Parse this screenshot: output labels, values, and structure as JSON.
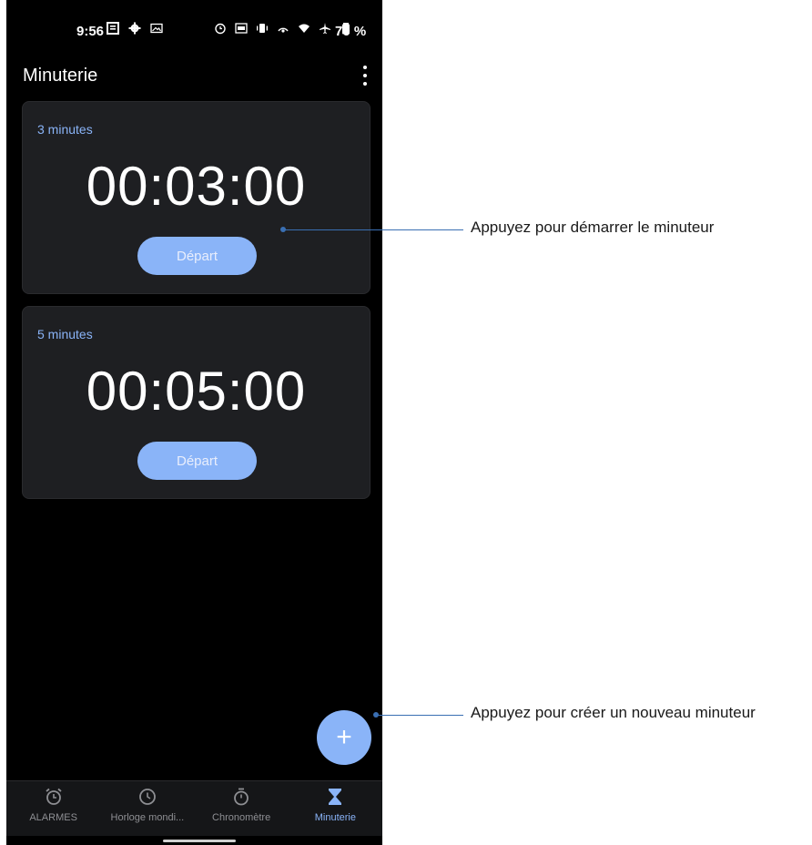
{
  "status_bar": {
    "time": "9:56",
    "battery": "70 %"
  },
  "app": {
    "title": "Minuterie"
  },
  "timers": [
    {
      "label": "3 minutes",
      "display": "00:03:00",
      "start_label": "Départ"
    },
    {
      "label": "5 minutes",
      "display": "00:05:00",
      "start_label": "Départ"
    }
  ],
  "fab": {
    "icon": "plus-icon",
    "glyph": "+"
  },
  "bottom_nav": [
    {
      "label": "ALARMES",
      "icon": "alarm-clock-icon"
    },
    {
      "label": "Horloge mondi...",
      "icon": "clock-icon"
    },
    {
      "label": "Chronomètre",
      "icon": "stopwatch-icon"
    },
    {
      "label": "Minuterie",
      "icon": "hourglass-icon",
      "active": true
    }
  ],
  "callouts": {
    "start": "Appuyez pour démarrer le minuteur",
    "new": "Appuyez pour créer un nouveau minuteur"
  },
  "colors": {
    "accent": "#8ab4f8",
    "background": "#000000",
    "card": "#1e1f22",
    "callout": "#3a6fb3"
  }
}
